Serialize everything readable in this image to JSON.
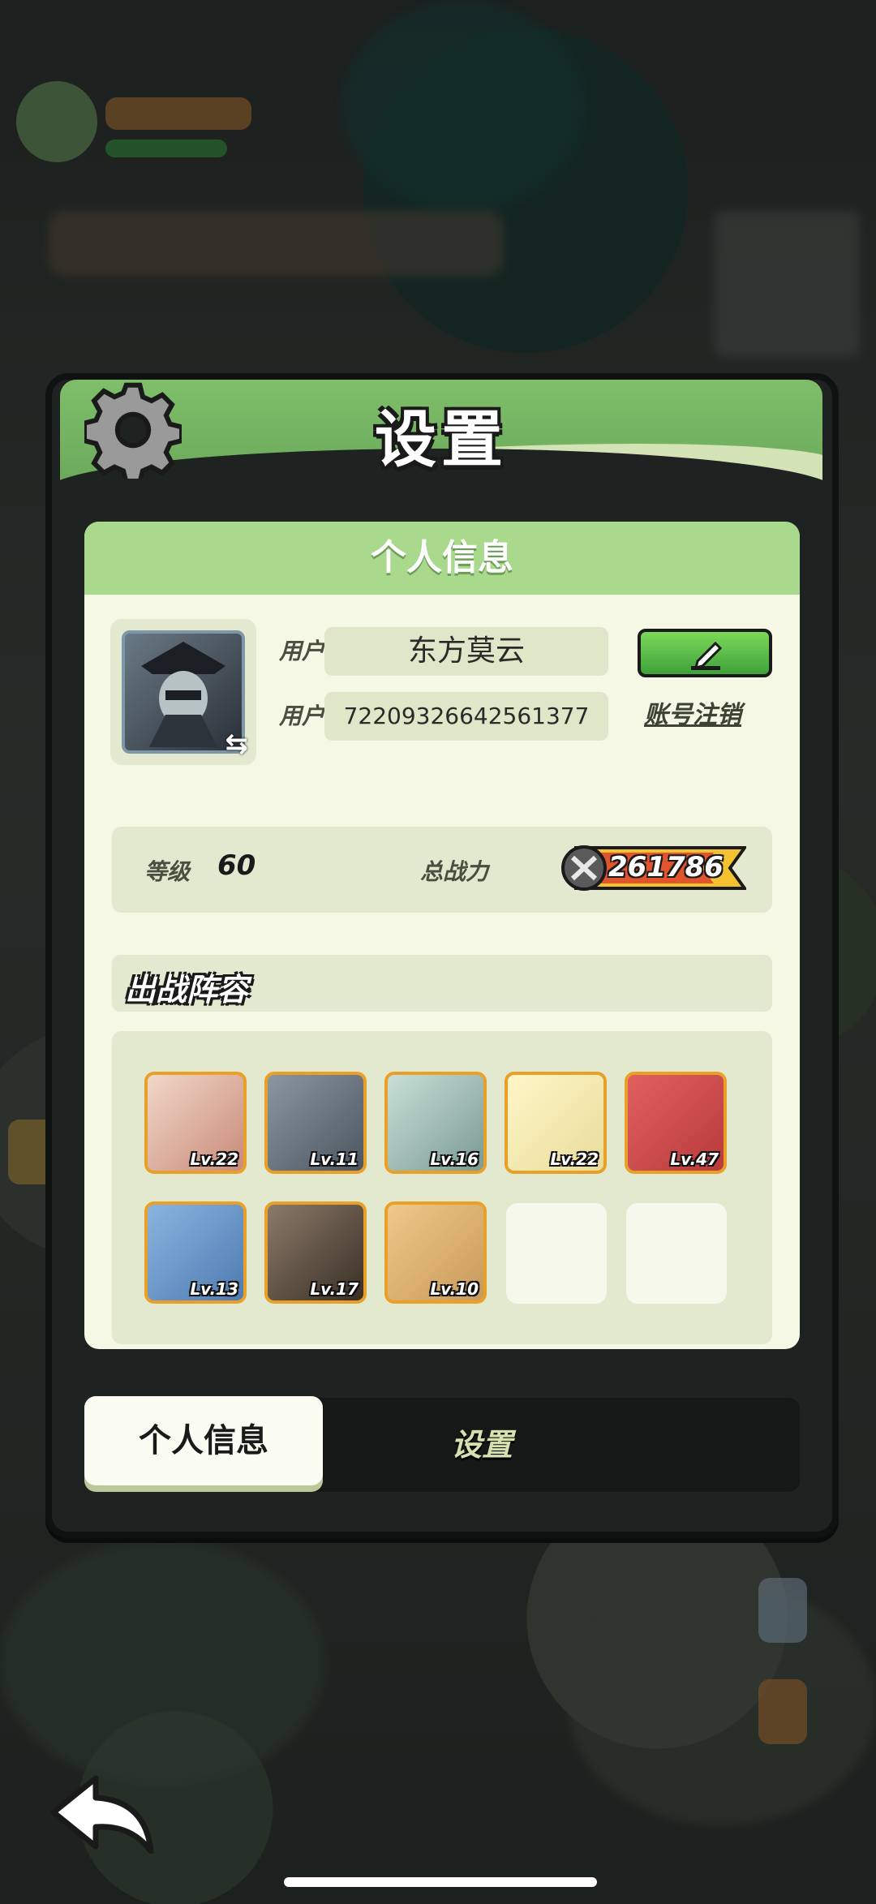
{
  "dialog": {
    "title": "设置",
    "section_title": "个人信息",
    "nickname_label": "用户昵称",
    "nickname_value": "东方莫云",
    "id_label": "用户 ID",
    "id_value": "72209326642561377",
    "delete_account_label": "账号注销",
    "level_label": "等级",
    "level_value": "60",
    "power_label": "总战力",
    "power_value": "261786",
    "lineup_title": "出战阵容",
    "heroes": [
      {
        "level": "Lv.22",
        "color": "#c98a7a"
      },
      {
        "level": "Lv.11",
        "color": "#4c5660"
      },
      {
        "level": "Lv.16",
        "color": "#7a9a92"
      },
      {
        "level": "Lv.22",
        "color": "#e8dc9a"
      },
      {
        "level": "Lv.47",
        "color": "#b83a3a"
      },
      {
        "level": "Lv.13",
        "color": "#4e7bb0"
      },
      {
        "level": "Lv.17",
        "color": "#5a4a3a"
      },
      {
        "level": "Lv.10",
        "color": "#c89a5a"
      }
    ]
  },
  "tabs": {
    "active": "个人信息",
    "other": "设置"
  }
}
